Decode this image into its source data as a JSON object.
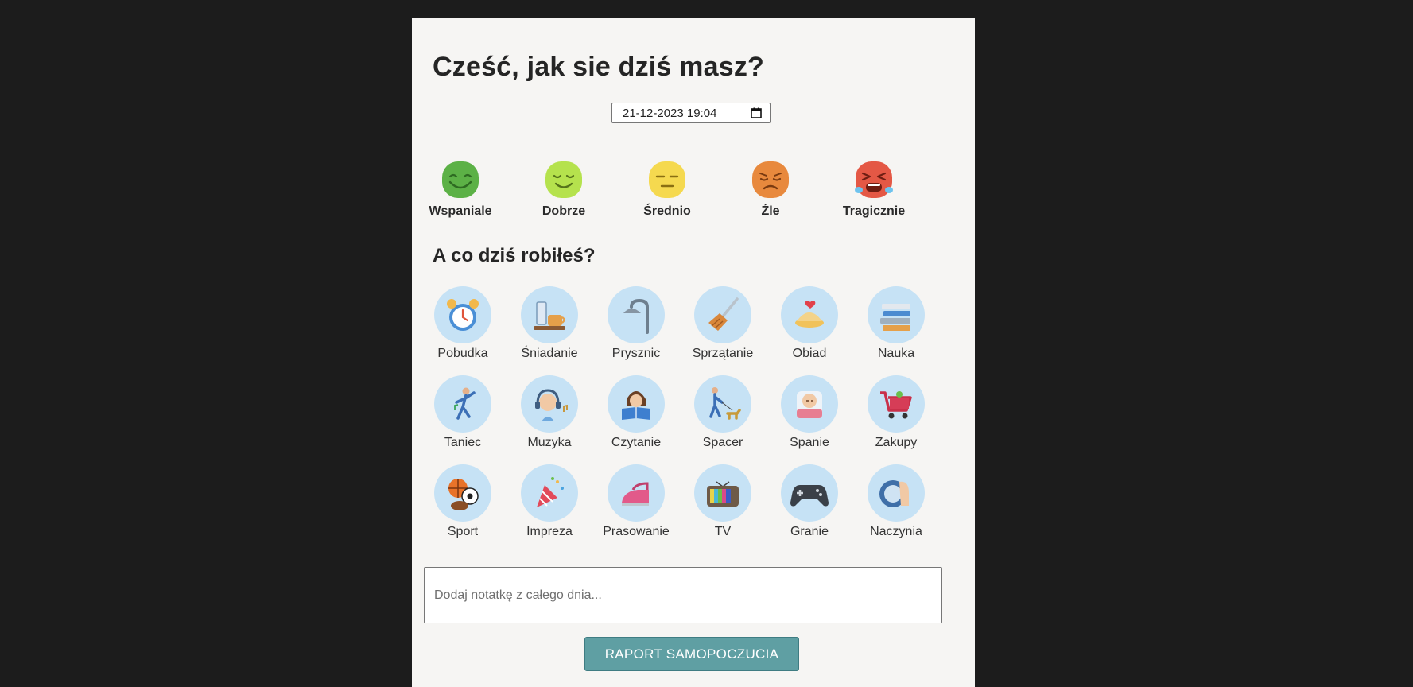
{
  "header": {
    "title": "Cześć, jak sie dziś masz?"
  },
  "date_input": {
    "value": "21-12-2023 19:04",
    "icon": "calendar-icon"
  },
  "moods": [
    {
      "label": "Wspaniale",
      "icon": "grinning-face-icon",
      "color": "#5cb146"
    },
    {
      "label": "Dobrze",
      "icon": "smiling-face-icon",
      "color": "#b5e24d"
    },
    {
      "label": "Średnio",
      "icon": "neutral-face-icon",
      "color": "#f5d94f"
    },
    {
      "label": "Źle",
      "icon": "sad-face-icon",
      "color": "#e8893d"
    },
    {
      "label": "Tragicznie",
      "icon": "crying-face-icon",
      "color": "#e45845"
    }
  ],
  "activities_section": {
    "title": "A co dziś robiłeś?",
    "items": [
      {
        "label": "Pobudka",
        "icon": "alarm-clock-icon"
      },
      {
        "label": "Śniadanie",
        "icon": "breakfast-icon"
      },
      {
        "label": "Prysznic",
        "icon": "shower-icon"
      },
      {
        "label": "Sprzątanie",
        "icon": "broom-icon"
      },
      {
        "label": "Obiad",
        "icon": "dinner-icon"
      },
      {
        "label": "Nauka",
        "icon": "books-icon"
      },
      {
        "label": "Taniec",
        "icon": "dancer-icon"
      },
      {
        "label": "Muzyka",
        "icon": "headphones-icon"
      },
      {
        "label": "Czytanie",
        "icon": "reading-icon"
      },
      {
        "label": "Spacer",
        "icon": "dog-walk-icon"
      },
      {
        "label": "Spanie",
        "icon": "sleeping-icon"
      },
      {
        "label": "Zakupy",
        "icon": "shopping-cart-icon"
      },
      {
        "label": "Sport",
        "icon": "balls-icon"
      },
      {
        "label": "Impreza",
        "icon": "party-popper-icon"
      },
      {
        "label": "Prasowanie",
        "icon": "iron-icon"
      },
      {
        "label": "TV",
        "icon": "tv-icon"
      },
      {
        "label": "Granie",
        "icon": "gamepad-icon"
      },
      {
        "label": "Naczynia",
        "icon": "dishes-icon"
      }
    ]
  },
  "note": {
    "placeholder": "Dodaj notatkę z całego dnia..."
  },
  "submit": {
    "label": "RAPORT SAMOPOCZUCIA"
  }
}
